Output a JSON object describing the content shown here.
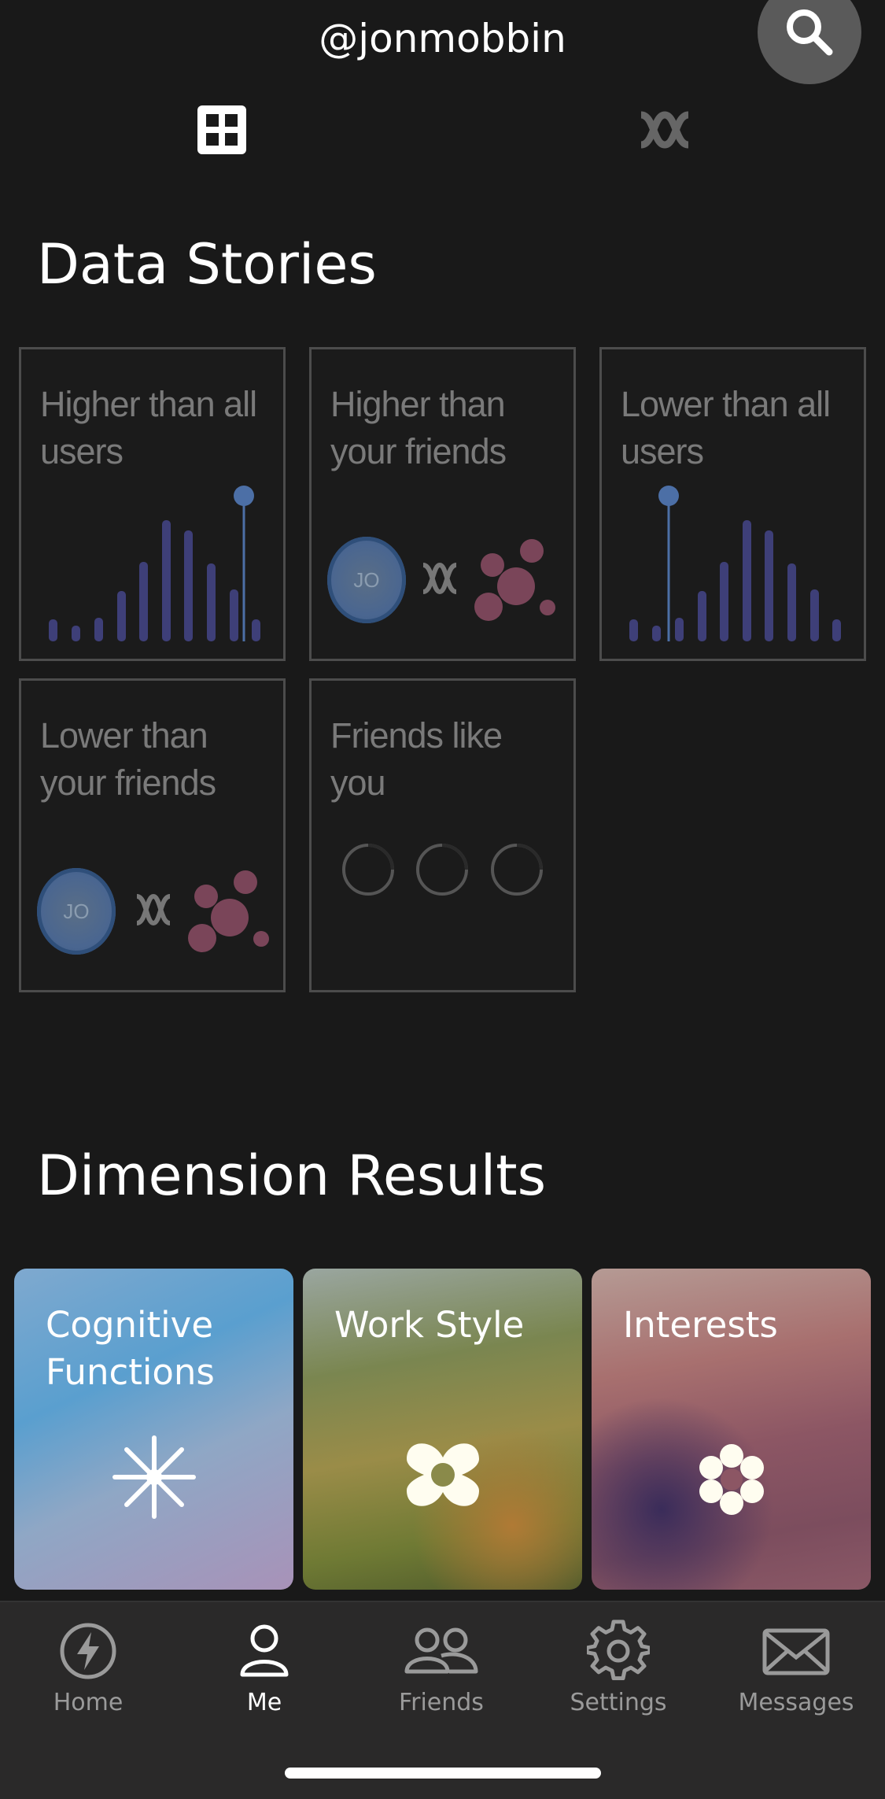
{
  "header": {
    "handle": "@jonmobbin"
  },
  "tabs": [
    {
      "name": "grid",
      "active": true
    },
    {
      "name": "compare",
      "active": false
    }
  ],
  "data_stories": {
    "title": "Data Stories",
    "cards": [
      {
        "label": "Higher than all users"
      },
      {
        "label": "Higher than your friends"
      },
      {
        "label": "Lower than all users"
      },
      {
        "label": "Lower than your friends"
      },
      {
        "label": "Friends like you"
      }
    ],
    "avatar_initials": "JO"
  },
  "dimension_results": {
    "title": "Dimension Results",
    "cards": [
      {
        "label": "Cognitive Functions",
        "icon": "sparkle-icon"
      },
      {
        "label": "Work Style",
        "icon": "quatrefoil-icon"
      },
      {
        "label": "Interests",
        "icon": "flower-icon"
      }
    ]
  },
  "nav": [
    {
      "label": "Home",
      "icon": "lightning-icon",
      "active": false
    },
    {
      "label": "Me",
      "icon": "person-icon",
      "active": true
    },
    {
      "label": "Friends",
      "icon": "friends-icon",
      "active": false
    },
    {
      "label": "Settings",
      "icon": "gear-icon",
      "active": false
    },
    {
      "label": "Messages",
      "icon": "envelope-icon",
      "active": false
    }
  ],
  "colors": {
    "background": "#191919",
    "bar": "#3e3f78",
    "marker": "#4c6fa6",
    "friend_dots": "#7a4559"
  }
}
